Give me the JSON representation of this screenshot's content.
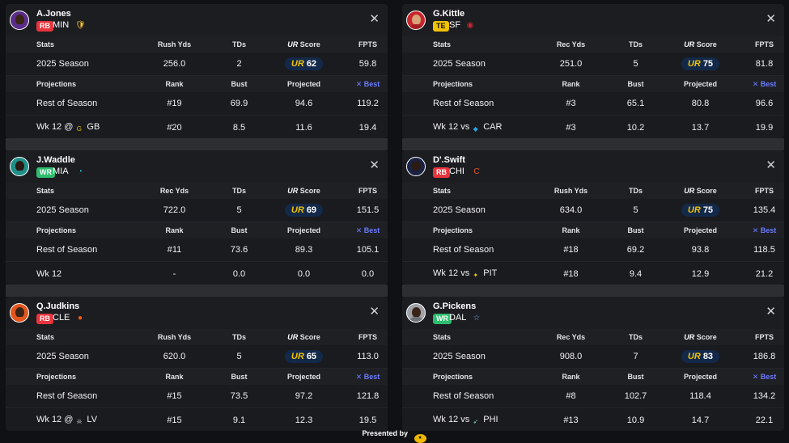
{
  "colors": {
    "rb_badge": "#e8343d",
    "wr_badge": "#2ebc6e",
    "te_badge": "#f2c200",
    "score_pill": "#13294a",
    "best_accent": "#6c7bff",
    "ur_logo": "#f2c200"
  },
  "footer": {
    "presented_by": "Presented by",
    "sponsor_icon": "sponsor-logo-icon"
  },
  "cards": [
    {
      "name": "A.Jones",
      "pos": "RB",
      "team": "MIN",
      "team_icon": "vikings-helmet-icon",
      "stat_label": "Rush Yds",
      "headers": {
        "stats": "Stats",
        "td": "TDs",
        "score": "Score",
        "fpts": "FPTS",
        "projections": "Projections",
        "rank": "Rank",
        "bust": "Bust",
        "projected": "Projected",
        "best": "Best"
      },
      "season": {
        "label": "2025 Season",
        "yds": "256.0",
        "tds": "2",
        "score": "62",
        "fpts": "59.8"
      },
      "ros": {
        "label": "Rest of Season",
        "rank": "#19",
        "bust": "69.9",
        "proj": "94.6",
        "best": "119.2"
      },
      "week": {
        "label": "Wk 12 @",
        "opp": "GB",
        "opp_icon": "packers-logo-icon",
        "rank": "#20",
        "bust": "8.5",
        "proj": "11.6",
        "best": "19.4"
      }
    },
    {
      "name": "J.Waddle",
      "pos": "WR",
      "team": "MIA",
      "team_icon": "dolphins-logo-icon",
      "stat_label": "Rec Yds",
      "headers": {
        "stats": "Stats",
        "td": "TDs",
        "score": "Score",
        "fpts": "FPTS",
        "projections": "Projections",
        "rank": "Rank",
        "bust": "Bust",
        "projected": "Projected",
        "best": "Best"
      },
      "season": {
        "label": "2025 Season",
        "yds": "722.0",
        "tds": "5",
        "score": "69",
        "fpts": "151.5"
      },
      "ros": {
        "label": "Rest of Season",
        "rank": "#11",
        "bust": "73.6",
        "proj": "89.3",
        "best": "105.1"
      },
      "week": {
        "label": "Wk 12",
        "opp": "",
        "opp_icon": "",
        "rank": "-",
        "bust": "0.0",
        "proj": "0.0",
        "best": "0.0"
      }
    },
    {
      "name": "Q.Judkins",
      "pos": "RB",
      "team": "CLE",
      "team_icon": "browns-helmet-icon",
      "stat_label": "Rush Yds",
      "headers": {
        "stats": "Stats",
        "td": "TDs",
        "score": "Score",
        "fpts": "FPTS",
        "projections": "Projections",
        "rank": "Rank",
        "bust": "Bust",
        "projected": "Projected",
        "best": "Best"
      },
      "season": {
        "label": "2025 Season",
        "yds": "620.0",
        "tds": "5",
        "score": "65",
        "fpts": "113.0"
      },
      "ros": {
        "label": "Rest of Season",
        "rank": "#15",
        "bust": "73.5",
        "proj": "97.2",
        "best": "121.8"
      },
      "week": {
        "label": "Wk 12 @",
        "opp": "LV",
        "opp_icon": "raiders-logo-icon",
        "rank": "#15",
        "bust": "9.1",
        "proj": "12.3",
        "best": "19.5"
      }
    },
    {
      "name": "G.Kittle",
      "pos": "TE",
      "team": "SF",
      "team_icon": "49ers-logo-icon",
      "stat_label": "Rec Yds",
      "headers": {
        "stats": "Stats",
        "td": "TDs",
        "score": "Score",
        "fpts": "FPTS",
        "projections": "Projections",
        "rank": "Rank",
        "bust": "Bust",
        "projected": "Projected",
        "best": "Best"
      },
      "season": {
        "label": "2025 Season",
        "yds": "251.0",
        "tds": "5",
        "score": "75",
        "fpts": "81.8"
      },
      "ros": {
        "label": "Rest of Season",
        "rank": "#3",
        "bust": "65.1",
        "proj": "80.8",
        "best": "96.6"
      },
      "week": {
        "label": "Wk 12 vs",
        "opp": "CAR",
        "opp_icon": "panthers-logo-icon",
        "rank": "#3",
        "bust": "10.2",
        "proj": "13.7",
        "best": "19.9"
      }
    },
    {
      "name": "D'.Swift",
      "pos": "RB",
      "team": "CHI",
      "team_icon": "bears-logo-icon",
      "stat_label": "Rush Yds",
      "headers": {
        "stats": "Stats",
        "td": "TDs",
        "score": "Score",
        "fpts": "FPTS",
        "projections": "Projections",
        "rank": "Rank",
        "bust": "Bust",
        "projected": "Projected",
        "best": "Best"
      },
      "season": {
        "label": "2025 Season",
        "yds": "634.0",
        "tds": "5",
        "score": "75",
        "fpts": "135.4"
      },
      "ros": {
        "label": "Rest of Season",
        "rank": "#18",
        "bust": "69.2",
        "proj": "93.8",
        "best": "118.5"
      },
      "week": {
        "label": "Wk 12 vs",
        "opp": "PIT",
        "opp_icon": "steelers-logo-icon",
        "rank": "#18",
        "bust": "9.4",
        "proj": "12.9",
        "best": "21.2"
      }
    },
    {
      "name": "G.Pickens",
      "pos": "WR",
      "team": "DAL",
      "team_icon": "cowboys-star-icon",
      "stat_label": "Rec Yds",
      "headers": {
        "stats": "Stats",
        "td": "TDs",
        "score": "Score",
        "fpts": "FPTS",
        "projections": "Projections",
        "rank": "Rank",
        "bust": "Bust",
        "projected": "Projected",
        "best": "Best"
      },
      "season": {
        "label": "2025 Season",
        "yds": "908.0",
        "tds": "7",
        "score": "83",
        "fpts": "186.8"
      },
      "ros": {
        "label": "Rest of Season",
        "rank": "#8",
        "bust": "102.7",
        "proj": "118.4",
        "best": "134.2"
      },
      "week": {
        "label": "Wk 12 vs",
        "opp": "PHI",
        "opp_icon": "eagles-logo-icon",
        "rank": "#13",
        "bust": "10.9",
        "proj": "14.7",
        "best": "22.1"
      }
    }
  ]
}
